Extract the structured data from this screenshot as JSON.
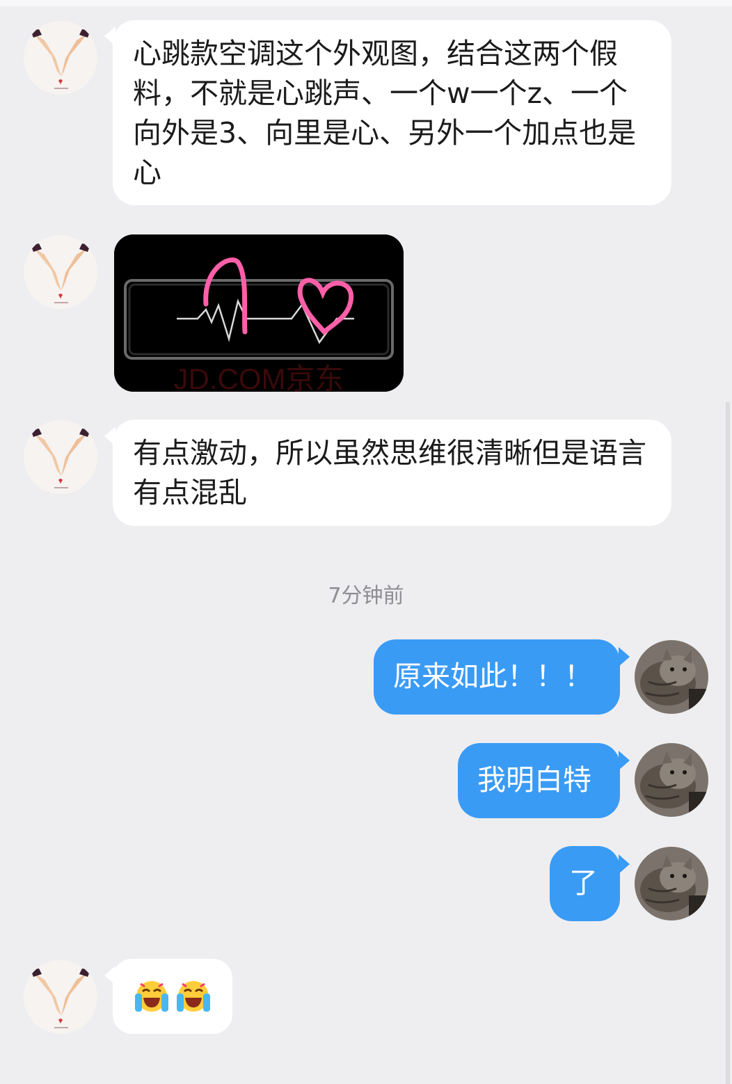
{
  "chat": {
    "timestamp": "7分钟前",
    "messages": [
      {
        "side": "in",
        "text": "心跳款空调这个外观图，结合这两个假料，不就是心跳声、一个w一个z、一个向外是3、向里是心、另外一个加点也是心"
      },
      {
        "side": "in",
        "type": "image",
        "image_desc_icon": "heartbeat-image",
        "watermark": "JD.COM京东"
      },
      {
        "side": "in",
        "text": "有点激动，所以虽然思维很清晰但是语言有点混乱"
      },
      {
        "side": "out",
        "text": "原来如此！！！"
      },
      {
        "side": "out",
        "text": "我明白特"
      },
      {
        "side": "out",
        "text": "了"
      },
      {
        "side": "in",
        "type": "emoji",
        "emoji_icons": [
          "crying-laughing-emoji",
          "crying-laughing-emoji"
        ]
      }
    ]
  },
  "colors": {
    "background": "#eeeef1",
    "incoming_bubble": "#ffffff",
    "outgoing_bubble": "#3a9bf5",
    "heart_stroke": "#ff5fa8"
  }
}
